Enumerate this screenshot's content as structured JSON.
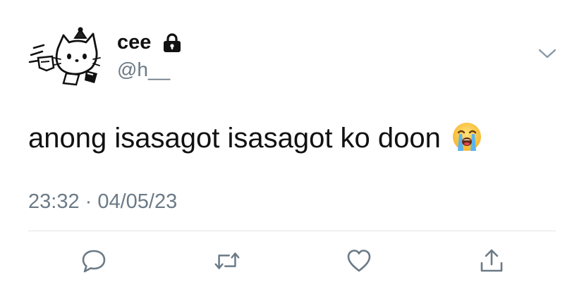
{
  "author": {
    "display_name": "cee",
    "handle": "@h__",
    "avatar_icon": "hello-kitty-doodle-avatar",
    "protected_icon": "lock-icon"
  },
  "tweet": {
    "text": "anong isasagot isasagot ko doon",
    "emoji": "loudly-crying-face-emoji",
    "timestamp": "23:32 · 04/05/23"
  },
  "actions": [
    {
      "name": "reply",
      "icon": "speech-bubble-icon"
    },
    {
      "name": "retweet",
      "icon": "retweet-arrows-icon"
    },
    {
      "name": "like",
      "icon": "heart-icon"
    },
    {
      "name": "share",
      "icon": "share-upload-icon"
    }
  ],
  "colors": {
    "text": "#111111",
    "secondary": "#6b7a86",
    "divider": "#dfe3e6",
    "icon": "#6b7a86"
  }
}
